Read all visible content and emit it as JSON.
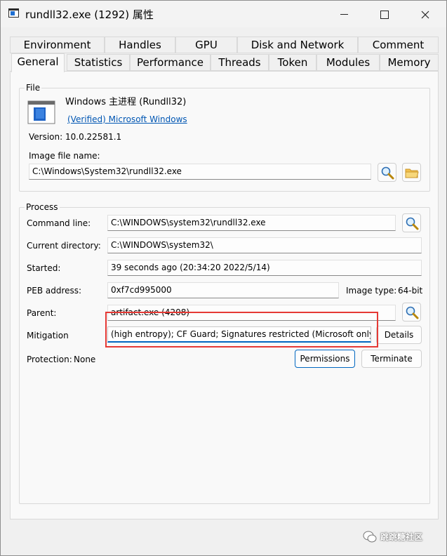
{
  "window": {
    "title": "rundll32.exe (1292) 属性",
    "minimize_icon": "minimize-icon",
    "maximize_icon": "maximize-icon",
    "close_icon": "close-icon"
  },
  "tabs": {
    "row1": [
      "Environment",
      "Handles",
      "GPU",
      "Disk and Network",
      "Comment"
    ],
    "row2": [
      "General",
      "Statistics",
      "Performance",
      "Threads",
      "Token",
      "Modules",
      "Memory"
    ],
    "active": "General"
  },
  "file": {
    "group_title": "File",
    "description": "Windows 主进程 (Rundll32)",
    "verified_link": "(Verified) Microsoft Windows",
    "version_label": "Version:",
    "version_value": "10.0.22581.1",
    "image_file_label": "Image file name:",
    "image_file_value": "C:\\Windows\\System32\\rundll32.exe"
  },
  "process": {
    "group_title": "Process",
    "command_line_label": "Command line:",
    "command_line_value": "C:\\WINDOWS\\system32\\rundll32.exe",
    "current_directory_label": "Current directory:",
    "current_directory_value": "C:\\WINDOWS\\system32\\",
    "started_label": "Started:",
    "started_value": "39 seconds ago (20:34:20 2022/5/14)",
    "peb_label": "PEB address:",
    "peb_value": "0xf7cd995000",
    "image_type_label": "Image type:",
    "image_type_value": "64-bit",
    "parent_label": "Parent:",
    "parent_value": "artifact.exe (4208)",
    "mitigation_label": "Mitigation",
    "mitigation_value": "(high entropy); CF Guard; Signatures restricted (Microsoft only)",
    "details_button": "Details",
    "protection_label": "Protection:",
    "protection_value": "None",
    "permissions_button": "Permissions",
    "terminate_button": "Terminate"
  },
  "watermark": {
    "text": "跳跳糖社区"
  },
  "colors": {
    "accent": "#0067c0",
    "link": "#0056b3",
    "highlight_box": "#e53935"
  }
}
